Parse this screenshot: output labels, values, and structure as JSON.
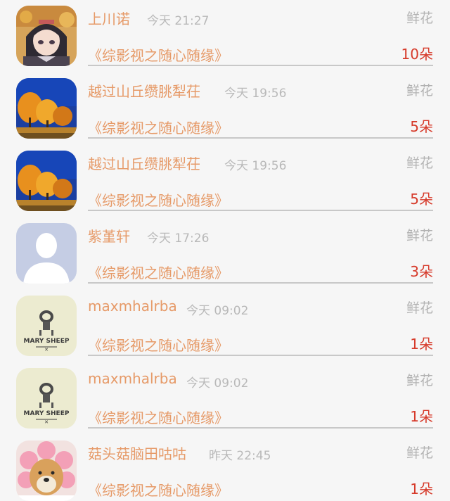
{
  "rows": [
    {
      "name": "上川诺",
      "time": "今天 21:27",
      "gift": "鲜花",
      "book": "《综影视之随心随缘》",
      "count": "10朵",
      "avatar": "anime-girl-avatar"
    },
    {
      "name": "越过山丘缵朓犁茌",
      "time": "今天 19:56",
      "gift": "鲜花",
      "book": "《综影视之随心随缘》",
      "count": "5朵",
      "avatar": "autumn-trees-avatar"
    },
    {
      "name": "越过山丘缵朓犁茌",
      "time": "今天 19:56",
      "gift": "鲜花",
      "book": "《综影视之随心随缘》",
      "count": "5朵",
      "avatar": "autumn-trees-avatar"
    },
    {
      "name": "紫堇轩",
      "time": "今天 17:26",
      "gift": "鲜花",
      "book": "《综影视之随心随缘》",
      "count": "3朵",
      "avatar": "default-user-avatar"
    },
    {
      "name": "maxmhalrba",
      "time": "今天 09:02",
      "gift": "鲜花",
      "book": "《综影视之随心随缘》",
      "count": "1朵",
      "avatar": "mary-sheep-avatar"
    },
    {
      "name": "maxmhalrba",
      "time": "今天 09:02",
      "gift": "鲜花",
      "book": "《综影视之随心随缘》",
      "count": "1朵",
      "avatar": "mary-sheep-avatar"
    },
    {
      "name": "菇头菇脑田咕咕",
      "time": "昨天 22:45",
      "gift": "鲜花",
      "book": "《综影视之随心随缘》",
      "count": "1朵",
      "avatar": "shiba-flower-avatar"
    }
  ],
  "logo_text": {
    "mary_sheep": "MARY SHEEP"
  },
  "colors": {
    "name": "#e69a68",
    "time": "#b9b9b9",
    "gift": "#b2b2b2",
    "count": "#d63a2a",
    "divider": "#c8c8c8",
    "background": "#f6f6f6"
  }
}
